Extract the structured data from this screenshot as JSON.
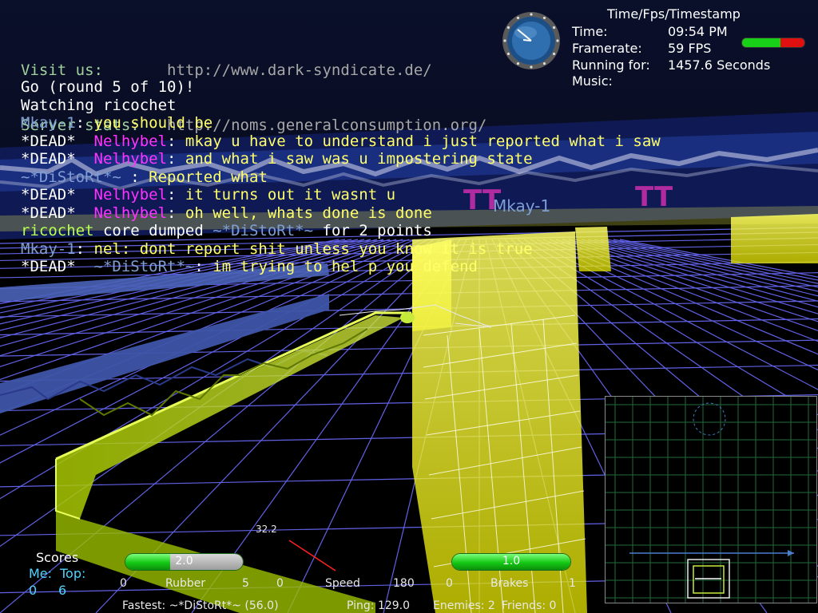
{
  "links": [
    {
      "label": "Visit us:",
      "url": "http://www.dark-syndicate.de/"
    },
    {
      "label": "Server stats:",
      "url": "http://noms.generalconsumption.org/"
    }
  ],
  "chat": [
    [
      {
        "text": "Go (round 5 of 10)!",
        "color": "white"
      }
    ],
    [
      {
        "text": "Watching ricochet",
        "color": "white"
      }
    ],
    [
      {
        "text": "Mkay-1",
        "color": "blue"
      },
      {
        "text": ": ",
        "color": "white"
      },
      {
        "text": "you should be",
        "color": "yellow"
      }
    ],
    [
      {
        "text": "*DEAD*  ",
        "color": "white"
      },
      {
        "text": "Nelhybel",
        "color": "magenta"
      },
      {
        "text": ": ",
        "color": "white"
      },
      {
        "text": "mkay u have to understand i just reported what i saw",
        "color": "yellow"
      }
    ],
    [
      {
        "text": "*DEAD*  ",
        "color": "white"
      },
      {
        "text": "Nelhybel",
        "color": "magenta"
      },
      {
        "text": ": ",
        "color": "white"
      },
      {
        "text": "and what i saw was u impostering state",
        "color": "yellow"
      }
    ],
    [
      {
        "text": "~*DiStoRt*~",
        "color": "blue"
      },
      {
        "text": " : ",
        "color": "white"
      },
      {
        "text": "Reported what",
        "color": "yellow"
      }
    ],
    [
      {
        "text": "*DEAD*  ",
        "color": "white"
      },
      {
        "text": "Nelhybel",
        "color": "magenta"
      },
      {
        "text": ": ",
        "color": "white"
      },
      {
        "text": "it turns out it wasnt u",
        "color": "yellow"
      }
    ],
    [
      {
        "text": "*DEAD*  ",
        "color": "white"
      },
      {
        "text": "Nelhybel",
        "color": "magenta"
      },
      {
        "text": ": ",
        "color": "white"
      },
      {
        "text": "oh well, whats done is done",
        "color": "yellow"
      }
    ],
    [
      {
        "text": "ricochet",
        "color": "green"
      },
      {
        "text": " core dumped ",
        "color": "white"
      },
      {
        "text": "~*DiStoRt*~",
        "color": "blue"
      },
      {
        "text": " for 2 points",
        "color": "white"
      }
    ],
    [
      {
        "text": "Mkay-1",
        "color": "blue"
      },
      {
        "text": ": ",
        "color": "white"
      },
      {
        "text": "nel: dont report shit unless you know it is true",
        "color": "yellow"
      }
    ],
    [
      {
        "text": "*DEAD*  ",
        "color": "white"
      },
      {
        "text": "~*DiStoRt*~",
        "color": "blue"
      },
      {
        "text": ": ",
        "color": "white"
      },
      {
        "text": "im trying to hel p you defend",
        "color": "yellow"
      }
    ]
  ],
  "status": {
    "title": "Time/Fps/Timestamp",
    "rows": [
      {
        "key": "Time:",
        "value": "09:54 PM"
      },
      {
        "key": "Framerate:",
        "value": "59 FPS"
      },
      {
        "key": "Running for:",
        "value": "1457.6 Seconds"
      },
      {
        "key": "Music:",
        "value": ""
      }
    ],
    "health_fraction": 0.62
  },
  "player_tag": "Mkay-1",
  "speed_readout": "32.2",
  "scores": {
    "title": "Scores",
    "me_label": "Me:",
    "top_label": "Top:",
    "me": "0",
    "top": "6"
  },
  "meters": {
    "rubber": {
      "value": "2.0",
      "fraction": 0.38,
      "label": "Rubber",
      "min": "0",
      "max": "5"
    },
    "speed": {
      "label": "Speed",
      "min": "0",
      "max": "180"
    },
    "brakes": {
      "value": "1.0",
      "fraction": 1.0,
      "label": "Brakes",
      "min": "0",
      "max": "1"
    }
  },
  "bottom": {
    "fastest": "Fastest: ~*DiStoRt*~ (56.0)",
    "ping": "Ping: 129.0",
    "enemies": "Enemies: 2",
    "friends": "Friends: 0"
  },
  "colors": {
    "wall_yellow": "#ffff44",
    "grid": "#6c6cff",
    "rim_blue": "#2c4a9a",
    "accent_green": "#b6ff50"
  }
}
